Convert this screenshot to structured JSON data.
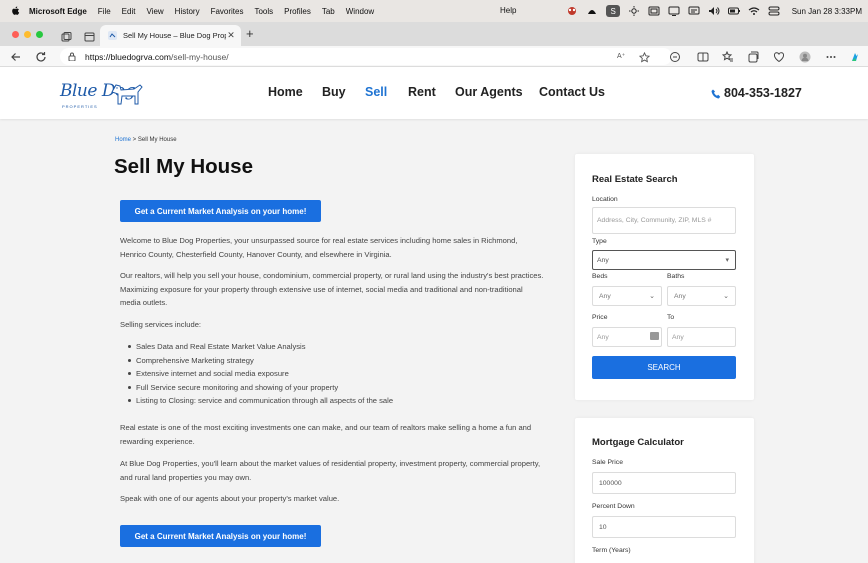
{
  "menubar": {
    "app": "Microsoft Edge",
    "items": [
      "File",
      "Edit",
      "View",
      "History",
      "Favorites",
      "Tools",
      "Profiles",
      "Tab",
      "Window"
    ],
    "help": "Help",
    "clock": "Sun Jan 28  3:33PM"
  },
  "browser": {
    "tab_title": "Sell My House – Blue Dog Prop",
    "url_host": "https://bluedogrva.com",
    "url_path": "/sell-my-house/",
    "reader_label": "A⁺"
  },
  "site": {
    "logo_text": "Blue Dog",
    "logo_sub": "PROPERTIES",
    "nav": [
      "Home",
      "Buy",
      "Sell",
      "Rent",
      "Our Agents",
      "Contact Us"
    ],
    "active_nav": "Sell",
    "phone": "804-353-1827"
  },
  "page": {
    "breadcrumb_home": "Home",
    "breadcrumb_sep": " > ",
    "breadcrumb_current": "Sell My House",
    "title": "Sell My House",
    "cta_label": "Get a Current Market Analysis on your home!",
    "p1": "Welcome to Blue Dog Properties, your unsurpassed source for real estate services including home sales in Richmond, Henrico County, Chesterfield County, Hanover County, and elsewhere in Virginia.",
    "p2": "Our realtors, will help you sell your house, condominium, commercial property, or rural land using the industry's best practices.  Maximizing exposure for your property through extensive use of internet, social media and traditional and non-traditional media outlets.",
    "p3": "Selling services include:",
    "services": [
      "Sales Data and Real Estate Market Value Analysis",
      "Comprehensive Marketing strategy",
      "Extensive internet and social media exposure",
      "Full Service secure monitoring and showing of your property",
      "Listing to Closing: service and communication through all aspects of the sale"
    ],
    "p4": "Real estate is one of the most exciting investments one can make, and our team of realtors make selling a home a fun and rewarding experience.",
    "p5": "At Blue Dog Properties, you'll  learn about the market values of residential property, investment property, commercial property, and rural land properties you may own.",
    "p6": "Speak with one of our agents about your property's market value."
  },
  "search": {
    "title": "Real Estate Search",
    "location_label": "Location",
    "location_placeholder": "Address, City, Community, ZIP, MLS #",
    "type_label": "Type",
    "type_value": "Any",
    "beds_label": "Beds",
    "beds_value": "Any",
    "baths_label": "Baths",
    "baths_value": "Any",
    "price_label": "Price",
    "price_placeholder": "Any",
    "to_label": "To",
    "to_placeholder": "Any",
    "button": "SEARCH"
  },
  "mortgage": {
    "title": "Mortgage Calculator",
    "sale_price_label": "Sale Price",
    "sale_price_value": "100000",
    "percent_down_label": "Percent Down",
    "percent_down_value": "10",
    "term_label": "Term (Years)"
  },
  "colors": {
    "accent": "#1a6fe0",
    "logo": "#1e5aa8"
  }
}
